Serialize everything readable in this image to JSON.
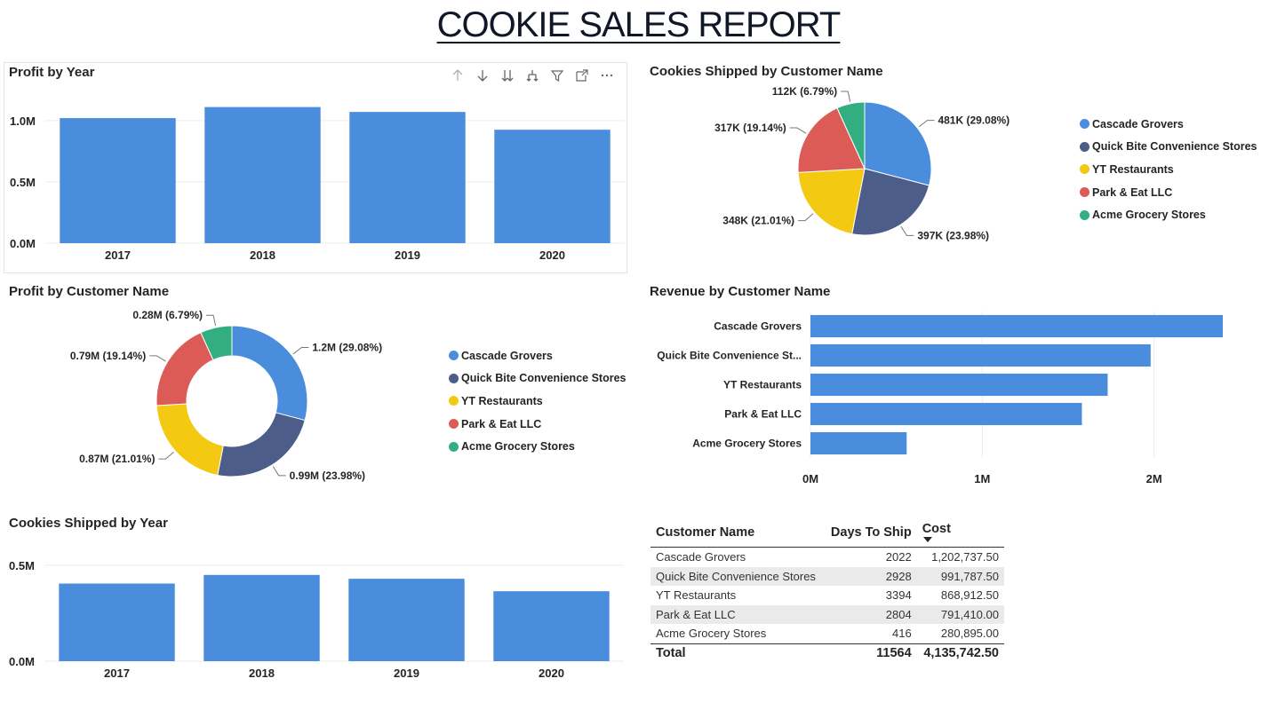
{
  "report": {
    "title": "COOKIE SALES REPORT"
  },
  "colors": {
    "bar": "#4a8ddc",
    "series": [
      "#4a8ddc",
      "#4c5d8a",
      "#f3c911",
      "#dc5b57",
      "#33ae81"
    ]
  },
  "toolbar": {
    "icons": [
      "arrow-up-icon",
      "arrow-down-icon",
      "expand-all-down-icon",
      "drill-down-icon",
      "filter-icon",
      "focus-mode-icon",
      "more-options-icon"
    ]
  },
  "chart_data": [
    {
      "id": "profit-by-year",
      "type": "bar",
      "title": "Profit by Year",
      "categories": [
        "2017",
        "2018",
        "2019",
        "2020"
      ],
      "values": [
        1020000,
        1110000,
        1070000,
        925000
      ],
      "ylim": [
        0,
        1100000
      ],
      "yticks": [
        {
          "value": 0,
          "label": "0.0M"
        },
        {
          "value": 500000,
          "label": "0.5M"
        },
        {
          "value": 1000000,
          "label": "1.0M"
        }
      ],
      "grid": true
    },
    {
      "id": "cookies-shipped-by-customer",
      "type": "pie",
      "title": "Cookies Shipped by Customer Name",
      "labels": [
        "Cascade Grovers",
        "Quick Bite Convenience Stores",
        "YT Restaurants",
        "Park & Eat LLC",
        "Acme Grocery Stores"
      ],
      "values": [
        29.08,
        23.98,
        21.01,
        19.14,
        6.79
      ],
      "data_labels": [
        "481K (29.08%)",
        "397K (23.98%)",
        "348K (21.01%)",
        "317K (19.14%)",
        "112K (6.79%)"
      ],
      "legend": "right"
    },
    {
      "id": "profit-by-customer",
      "type": "pie",
      "title": "Profit by Customer Name",
      "labels": [
        "Cascade Grovers",
        "Quick Bite Convenience Stores",
        "YT Restaurants",
        "Park & Eat LLC",
        "Acme Grocery Stores"
      ],
      "values": [
        29.08,
        23.98,
        21.01,
        19.14,
        6.79
      ],
      "data_labels": [
        "1.2M (29.08%)",
        "0.99M (23.98%)",
        "0.87M (21.01%)",
        "0.79M (19.14%)",
        "0.28M (6.79%)"
      ],
      "donut": true,
      "legend": "right"
    },
    {
      "id": "revenue-by-customer",
      "type": "bar",
      "orientation": "horizontal",
      "title": "Revenue by Customer Name",
      "categories": [
        "Cascade Grovers",
        "Quick Bite Convenience St...",
        "YT Restaurants",
        "Park & Eat LLC",
        "Acme Grocery Stores"
      ],
      "values": [
        2400000,
        1980000,
        1730000,
        1580000,
        560000
      ],
      "xlim": [
        0,
        2400000
      ],
      "xticks": [
        {
          "value": 0,
          "label": "0M"
        },
        {
          "value": 1000000,
          "label": "1M"
        },
        {
          "value": 2000000,
          "label": "2M"
        }
      ],
      "grid": true
    },
    {
      "id": "cookies-shipped-by-year",
      "type": "bar",
      "title": "Cookies Shipped by Year",
      "categories": [
        "2017",
        "2018",
        "2019",
        "2020"
      ],
      "values": [
        405000,
        450000,
        430000,
        365000
      ],
      "ylim": [
        0,
        500000
      ],
      "yticks": [
        {
          "value": 0,
          "label": "0.0M"
        },
        {
          "value": 500000,
          "label": "0.5M"
        }
      ],
      "grid": true
    },
    {
      "id": "customer-table",
      "type": "table",
      "columns": [
        "Customer Name",
        "Days To Ship",
        "Cost"
      ],
      "rows": [
        [
          "Cascade Grovers",
          "2022",
          "1,202,737.50"
        ],
        [
          "Quick Bite Convenience Stores",
          "2928",
          "991,787.50"
        ],
        [
          "YT Restaurants",
          "3394",
          "868,912.50"
        ],
        [
          "Park & Eat LLC",
          "2804",
          "791,410.00"
        ],
        [
          "Acme Grocery Stores",
          "416",
          "280,895.00"
        ]
      ],
      "total": [
        "Total",
        "11564",
        "4,135,742.50"
      ],
      "sorted_by": "Cost"
    }
  ]
}
